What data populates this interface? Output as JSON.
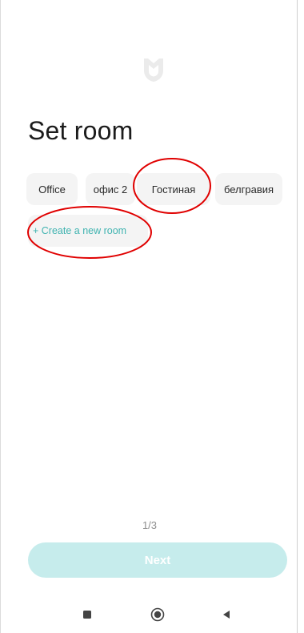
{
  "header": {
    "logo_icon": "mi-home-logo-icon",
    "title": "Set room"
  },
  "rooms": [
    {
      "label": "Office"
    },
    {
      "label": "офис 2"
    },
    {
      "label": "Гостиная"
    },
    {
      "label": "белгравия"
    }
  ],
  "create_room": {
    "label": "+ Create a new room"
  },
  "pager": {
    "text": "1/3"
  },
  "footer": {
    "next_label": "Next"
  },
  "nav": {
    "recent_icon": "square-recent-apps-icon",
    "home_icon": "circle-home-icon",
    "back_icon": "triangle-back-icon"
  },
  "colors": {
    "accent": "#3fb3b0",
    "next_button_bg": "#c6ecec",
    "chip_bg": "#f4f4f4",
    "annotation": "#e00000"
  }
}
